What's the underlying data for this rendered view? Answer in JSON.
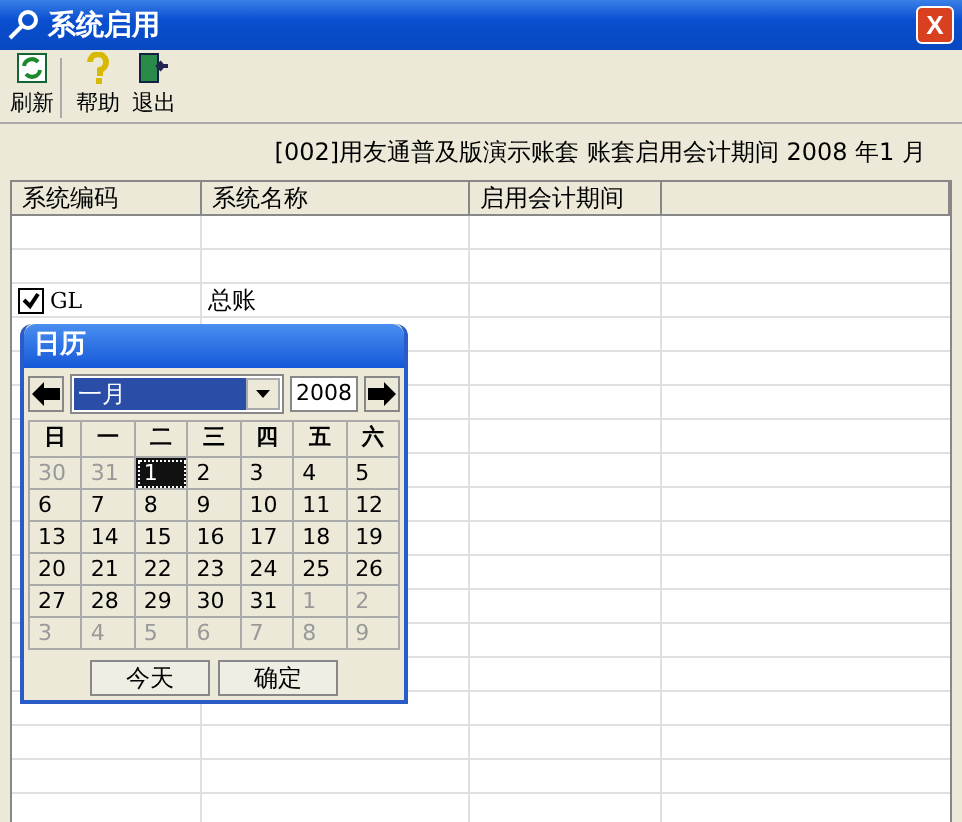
{
  "window": {
    "title": "系统启用",
    "close": "X"
  },
  "toolbar": [
    {
      "label": "刷新"
    },
    {
      "label": "帮助"
    },
    {
      "label": "退出"
    }
  ],
  "info": "[002]用友通普及版演示账套 账套启用会计期间 2008 年1 月",
  "table": {
    "columns": [
      "系统编码",
      "系统名称",
      "启用会计期间"
    ],
    "rows": [
      {
        "code": "GL",
        "name": "总账",
        "checked": true
      }
    ]
  },
  "calendar": {
    "title": "日历",
    "month": "一月",
    "year": "2008",
    "weekdays": [
      "日",
      "一",
      "二",
      "三",
      "四",
      "五",
      "六"
    ],
    "days": [
      {
        "text": "30",
        "in_month": false,
        "selected": false
      },
      {
        "text": "31",
        "in_month": false,
        "selected": false
      },
      {
        "text": "1",
        "in_month": true,
        "selected": true
      },
      {
        "text": "2",
        "in_month": true,
        "selected": false
      },
      {
        "text": "3",
        "in_month": true,
        "selected": false
      },
      {
        "text": "4",
        "in_month": true,
        "selected": false
      },
      {
        "text": "5",
        "in_month": true,
        "selected": false
      },
      {
        "text": "6",
        "in_month": true,
        "selected": false
      },
      {
        "text": "7",
        "in_month": true,
        "selected": false
      },
      {
        "text": "8",
        "in_month": true,
        "selected": false
      },
      {
        "text": "9",
        "in_month": true,
        "selected": false
      },
      {
        "text": "10",
        "in_month": true,
        "selected": false
      },
      {
        "text": "11",
        "in_month": true,
        "selected": false
      },
      {
        "text": "12",
        "in_month": true,
        "selected": false
      },
      {
        "text": "13",
        "in_month": true,
        "selected": false
      },
      {
        "text": "14",
        "in_month": true,
        "selected": false
      },
      {
        "text": "15",
        "in_month": true,
        "selected": false
      },
      {
        "text": "16",
        "in_month": true,
        "selected": false
      },
      {
        "text": "17",
        "in_month": true,
        "selected": false
      },
      {
        "text": "18",
        "in_month": true,
        "selected": false
      },
      {
        "text": "19",
        "in_month": true,
        "selected": false
      },
      {
        "text": "20",
        "in_month": true,
        "selected": false
      },
      {
        "text": "21",
        "in_month": true,
        "selected": false
      },
      {
        "text": "22",
        "in_month": true,
        "selected": false
      },
      {
        "text": "23",
        "in_month": true,
        "selected": false
      },
      {
        "text": "24",
        "in_month": true,
        "selected": false
      },
      {
        "text": "25",
        "in_month": true,
        "selected": false
      },
      {
        "text": "26",
        "in_month": true,
        "selected": false
      },
      {
        "text": "27",
        "in_month": true,
        "selected": false
      },
      {
        "text": "28",
        "in_month": true,
        "selected": false
      },
      {
        "text": "29",
        "in_month": true,
        "selected": false
      },
      {
        "text": "30",
        "in_month": true,
        "selected": false
      },
      {
        "text": "31",
        "in_month": true,
        "selected": false
      },
      {
        "text": "1",
        "in_month": false,
        "selected": false
      },
      {
        "text": "2",
        "in_month": false,
        "selected": false
      },
      {
        "text": "3",
        "in_month": false,
        "selected": false
      },
      {
        "text": "4",
        "in_month": false,
        "selected": false
      },
      {
        "text": "5",
        "in_month": false,
        "selected": false
      },
      {
        "text": "6",
        "in_month": false,
        "selected": false
      },
      {
        "text": "7",
        "in_month": false,
        "selected": false
      },
      {
        "text": "8",
        "in_month": false,
        "selected": false
      },
      {
        "text": "9",
        "in_month": false,
        "selected": false
      }
    ],
    "buttons": [
      "今天",
      "确定"
    ]
  }
}
